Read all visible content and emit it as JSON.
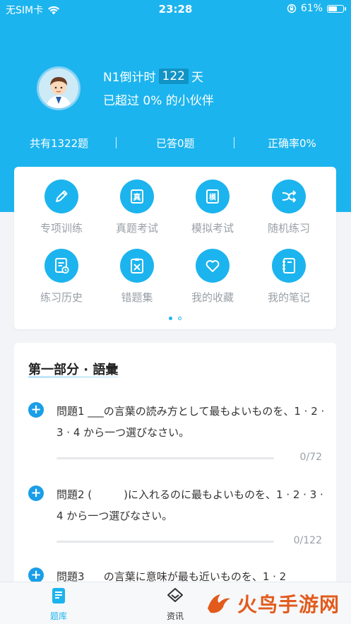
{
  "status_bar": {
    "carrier": "无SIM卡",
    "time": "23:28",
    "battery_percent": "61%",
    "battery_level": 0.61
  },
  "header": {
    "exam_prefix": "N1倒计时",
    "countdown_days": "122",
    "days_unit": "天",
    "percentile_text": "已超过 0% 的小伙伴"
  },
  "stats": {
    "total": "共有1322题",
    "answered": "已答0题",
    "accuracy": "正确率0%"
  },
  "grid": {
    "items": [
      {
        "label": "专项训练",
        "icon": "pencil-icon"
      },
      {
        "label": "真题考试",
        "icon": "real-exam-icon"
      },
      {
        "label": "模拟考试",
        "icon": "mock-exam-icon"
      },
      {
        "label": "随机练习",
        "icon": "shuffle-icon"
      },
      {
        "label": "练习历史",
        "icon": "history-icon"
      },
      {
        "label": "错题集",
        "icon": "wrong-questions-icon"
      },
      {
        "label": "我的收藏",
        "icon": "heart-icon"
      },
      {
        "label": "我的笔记",
        "icon": "notebook-icon"
      }
    ],
    "page_index": 1,
    "page_count": 2
  },
  "section": {
    "title": "第一部分 · 語彙",
    "questions": [
      {
        "text": "問題1 ___の言葉の読み方として最もよいものを、1 · 2 · 3 · 4 から一つ選びなさい。",
        "count": "0/72",
        "progress": 0
      },
      {
        "text": "問題2 (　　　)に入れるのに最もよいものを、1 · 2 · 3 · 4 から一つ選びなさい。",
        "count": "0/122",
        "progress": 0
      },
      {
        "text": "問題3 ___の言葉に意味が最も近いものを、1 · 2",
        "count": "",
        "progress": 0
      }
    ]
  },
  "tabbar": {
    "tabs": [
      {
        "label": "题库",
        "icon": "question-bank-icon",
        "active": true
      },
      {
        "label": "资讯",
        "icon": "news-icon",
        "active": false
      }
    ]
  },
  "watermark": {
    "text": "火鸟手游网"
  },
  "colors": {
    "primary": "#1cb4ee",
    "background": "#f2f4f7",
    "muted_text": "#9aa0a6",
    "watermark": "#e25b1d"
  }
}
